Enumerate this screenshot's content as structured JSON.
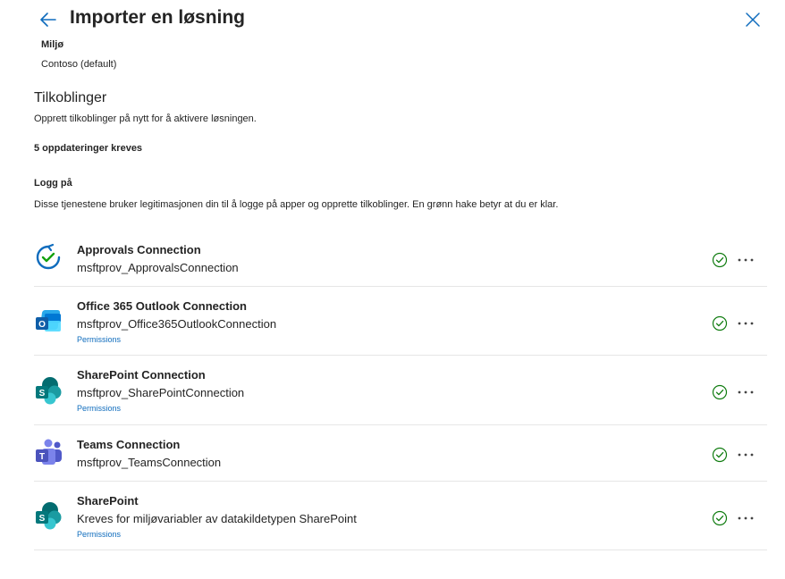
{
  "header": {
    "title": "Importer en løsning",
    "back_icon": "arrow-left-icon",
    "close_icon": "close-icon"
  },
  "environment": {
    "label": "Miljø",
    "value": "Contoso (default)"
  },
  "connections_section": {
    "title": "Tilkoblinger",
    "description": "Opprett tilkoblinger på nytt for å aktivere løsningen.",
    "updates_required": "5 oppdateringer kreves",
    "login_title": "Logg på",
    "login_description": "Disse tjenestene bruker legitimasjonen din til å logge på apper og opprette tilkoblinger. En grønn hake betyr at du er klar."
  },
  "connections": [
    {
      "name": "Approvals Connection",
      "subtitle": "msftprov_ApprovalsConnection",
      "icon": "approvals-icon",
      "status": "connected"
    },
    {
      "name": "Office 365 Outlook Connection",
      "subtitle": "msftprov_Office365OutlookConnection",
      "permissions": "Permissions",
      "icon": "outlook-icon",
      "status": "connected"
    },
    {
      "name": "SharePoint Connection",
      "subtitle": "msftprov_SharePointConnection",
      "permissions": "Permissions",
      "icon": "sharepoint-icon",
      "status": "connected"
    },
    {
      "name": "Teams Connection",
      "subtitle": "msftprov_TeamsConnection",
      "icon": "teams-icon",
      "status": "connected"
    },
    {
      "name": "SharePoint",
      "subtitle": "Kreves for miljøvariabler av datakildetypen SharePoint",
      "permissions": "Permissions",
      "icon": "sharepoint-icon",
      "status": "connected"
    }
  ],
  "colors": {
    "accent": "#0f6cbd",
    "success": "#107c10",
    "divider": "#e6e6e6"
  }
}
